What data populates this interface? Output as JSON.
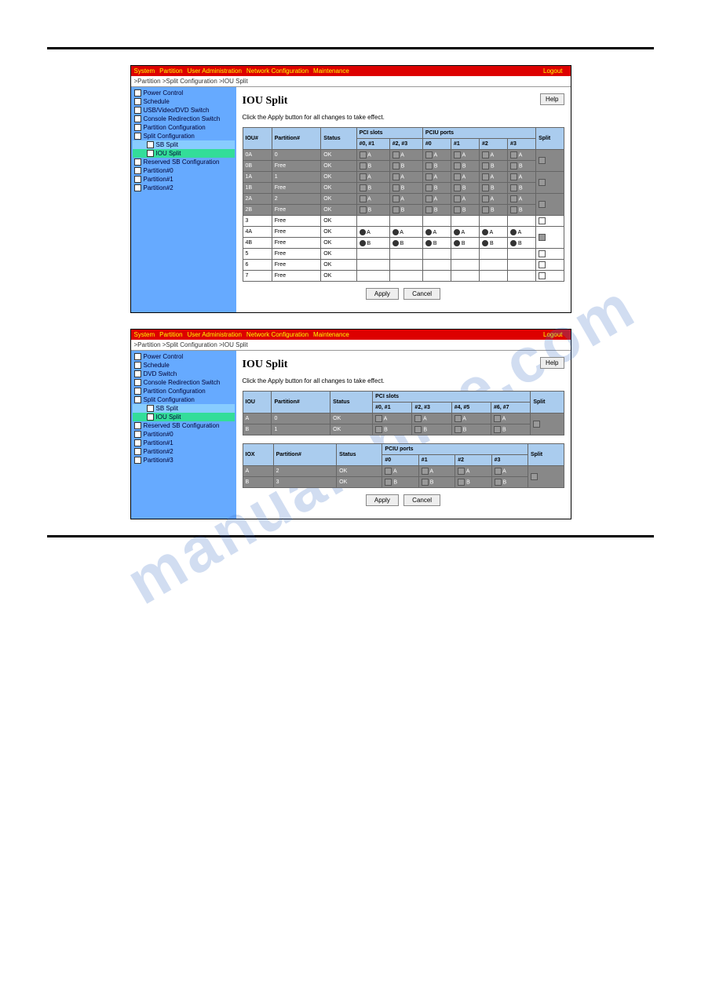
{
  "header": {
    "menu": [
      "System",
      "Partition",
      "User Administration",
      "Network Configuration",
      "Maintenance"
    ],
    "logout": "Logout",
    "breadcrumb": ">Partition >Split Configuration >IOU Split"
  },
  "sidebar1": [
    "Power Control",
    "Schedule",
    "USB/Video/DVD Switch",
    "Console Redirection Switch",
    "Partition Configuration",
    "Split Configuration",
    "SB Split",
    "IOU Split",
    "Reserved SB Configuration",
    "Partition#0",
    "Partition#1",
    "Partition#2"
  ],
  "sidebar2": [
    "Power Control",
    "Schedule",
    "DVD Switch",
    "Console Redirection Switch",
    "Partition Configuration",
    "Split Configuration",
    "SB Split",
    "IOU Split",
    "Reserved SB Configuration",
    "Partition#0",
    "Partition#1",
    "Partition#2",
    "Partition#3"
  ],
  "main": {
    "title": "IOU Split",
    "desc": "Click the Apply button for all changes to take effect.",
    "help": "Help",
    "apply": "Apply",
    "cancel": "Cancel"
  },
  "table1": {
    "headers": [
      "IOU#",
      "Partition#",
      "Status",
      "PCI slots",
      "PCIU ports",
      "Split"
    ],
    "sub_pci": [
      "#0, #1",
      "#2, #3"
    ],
    "sub_pciu": [
      "#0",
      "#1",
      "#2",
      "#3"
    ],
    "rows": [
      {
        "iou": "0A",
        "part": "0",
        "status": "OK",
        "pci": [
          "A",
          "A"
        ],
        "pciu": [
          "A",
          "A",
          "A",
          "A"
        ],
        "cls": "grey-row",
        "split": true
      },
      {
        "iou": "0B",
        "part": "Free",
        "status": "OK",
        "pci": [
          "B",
          "B"
        ],
        "pciu": [
          "B",
          "B",
          "B",
          "B"
        ],
        "cls": "grey-row"
      },
      {
        "iou": "1A",
        "part": "1",
        "status": "OK",
        "pci": [
          "A",
          "A"
        ],
        "pciu": [
          "A",
          "A",
          "A",
          "A"
        ],
        "cls": "grey-row",
        "split": true
      },
      {
        "iou": "1B",
        "part": "Free",
        "status": "OK",
        "pci": [
          "B",
          "B"
        ],
        "pciu": [
          "B",
          "B",
          "B",
          "B"
        ],
        "cls": "grey-row"
      },
      {
        "iou": "2A",
        "part": "2",
        "status": "OK",
        "pci": [
          "A",
          "A"
        ],
        "pciu": [
          "A",
          "A",
          "A",
          "A"
        ],
        "cls": "grey-row",
        "split": true
      },
      {
        "iou": "2B",
        "part": "Free",
        "status": "OK",
        "pci": [
          "B",
          "B"
        ],
        "pciu": [
          "B",
          "B",
          "B",
          "B"
        ],
        "cls": "grey-row"
      },
      {
        "iou": "3",
        "part": "Free",
        "status": "OK",
        "pci": [
          "",
          ""
        ],
        "pciu": [
          "",
          "",
          "",
          ""
        ],
        "cls": "light-row",
        "split": false
      },
      {
        "iou": "4A",
        "part": "Free",
        "status": "OK",
        "pci": [
          "A",
          "A"
        ],
        "pciu": [
          "A",
          "A",
          "A",
          "A"
        ],
        "cls": "light-row",
        "radio": true,
        "split": true
      },
      {
        "iou": "4B",
        "part": "Free",
        "status": "OK",
        "pci": [
          "B",
          "B"
        ],
        "pciu": [
          "B",
          "B",
          "B",
          "B"
        ],
        "cls": "light-row",
        "radio": true
      },
      {
        "iou": "5",
        "part": "Free",
        "status": "OK",
        "pci": [
          "",
          ""
        ],
        "pciu": [
          "",
          "",
          "",
          ""
        ],
        "cls": "light-row",
        "split": false
      },
      {
        "iou": "6",
        "part": "Free",
        "status": "OK",
        "pci": [
          "",
          ""
        ],
        "pciu": [
          "",
          "",
          "",
          ""
        ],
        "cls": "light-row",
        "split": false
      },
      {
        "iou": "7",
        "part": "Free",
        "status": "OK",
        "pci": [
          "",
          ""
        ],
        "pciu": [
          "",
          "",
          "",
          ""
        ],
        "cls": "light-row",
        "split": false
      }
    ]
  },
  "table2a": {
    "headers": [
      "IOU",
      "Partition#",
      "Status",
      "PCI slots",
      "Split"
    ],
    "sub": [
      "#0, #1",
      "#2, #3",
      "#4, #5",
      "#6, #7"
    ],
    "rows": [
      {
        "iou": "A",
        "part": "0",
        "status": "OK",
        "slots": [
          "A",
          "A",
          "A",
          "A"
        ],
        "cls": "grey-row"
      },
      {
        "iou": "B",
        "part": "1",
        "status": "OK",
        "slots": [
          "B",
          "B",
          "B",
          "B"
        ],
        "cls": "grey-row"
      }
    ]
  },
  "table2b": {
    "headers": [
      "IOX",
      "Partition#",
      "Status",
      "PCIU ports",
      "Split"
    ],
    "sub": [
      "#0",
      "#1",
      "#2",
      "#3"
    ],
    "rows": [
      {
        "iou": "A",
        "part": "2",
        "status": "OK",
        "slots": [
          "A",
          "A",
          "A",
          "A"
        ],
        "cls": "grey-row"
      },
      {
        "iou": "B",
        "part": "3",
        "status": "OK",
        "slots": [
          "B",
          "B",
          "B",
          "B"
        ],
        "cls": "grey-row"
      }
    ]
  }
}
